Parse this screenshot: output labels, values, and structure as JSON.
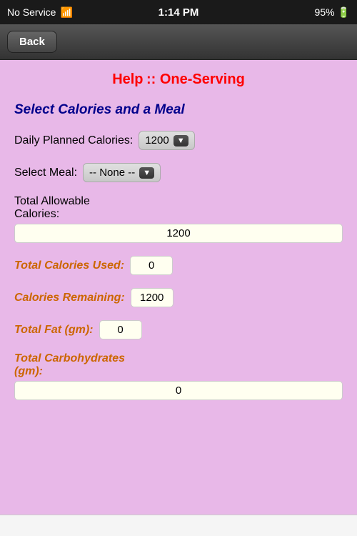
{
  "statusBar": {
    "noService": "No Service",
    "wifi": "⇡",
    "time": "1:14 PM",
    "battery": "95%"
  },
  "navBar": {
    "backLabel": "Back"
  },
  "pageTitle": {
    "help": "Help",
    "separator": " :: ",
    "sub": "One-Serving"
  },
  "sectionHeader": "Select Calories and a Meal",
  "form": {
    "dailyCaloriesLabel": "Daily Planned Calories:",
    "dailyCaloriesValue": "1200",
    "selectMealLabel": "Select Meal:",
    "selectMealValue": "-- None --",
    "totalAllowableLabel": "Total Allowable\nCalories:",
    "totalAllowableValue": "1200",
    "totalCaloriesUsedLabel": "Total Calories Used:",
    "totalCaloriesUsedValue": "0",
    "caloriesRemainingLabel": "Calories Remaining:",
    "caloriesRemainingValue": "1200",
    "totalFatLabel": "Total Fat (gm):",
    "totalFatValue": "0",
    "totalCarbsLabel": "Total Carbohydrates (gm):",
    "totalCarbsValue": "0"
  }
}
